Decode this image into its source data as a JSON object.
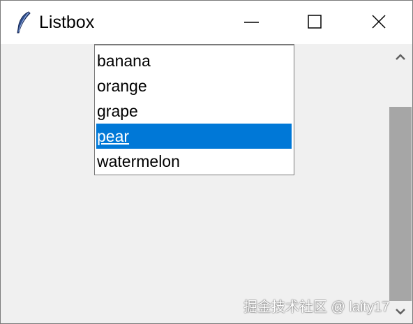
{
  "window": {
    "title": "Listbox"
  },
  "icons": {
    "app": "feather-icon",
    "minimize": "minimize-icon",
    "maximize": "maximize-icon",
    "close": "close-icon",
    "scroll_up": "chevron-up-icon",
    "scroll_down": "chevron-down-icon"
  },
  "listbox": {
    "items": [
      {
        "label": "banana",
        "selected": false
      },
      {
        "label": "orange",
        "selected": false
      },
      {
        "label": "grape",
        "selected": false
      },
      {
        "label": "pear",
        "selected": true
      },
      {
        "label": "watermelon",
        "selected": false
      }
    ]
  },
  "colors": {
    "selection": "#0078d7",
    "window_bg": "#f0f0f0",
    "scroll_thumb": "#a6a6a6"
  },
  "watermark": {
    "text": "掘金技术社区 @ laity17"
  }
}
